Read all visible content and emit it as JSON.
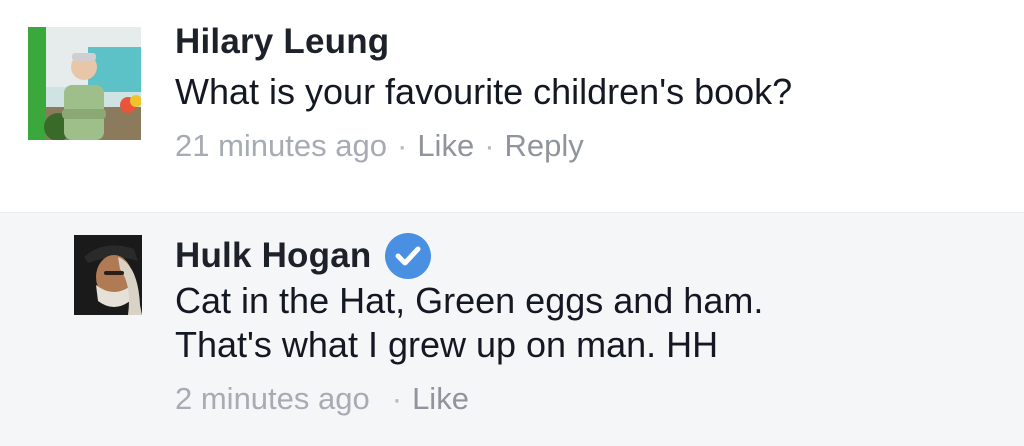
{
  "comments": [
    {
      "author": "Hilary Leung",
      "text_lines": [
        "What is your favourite children's book?"
      ],
      "time": "21 minutes ago",
      "separator": "·",
      "like_label": "Like",
      "reply_label": "Reply",
      "verified": false
    },
    {
      "author": "Hulk Hogan",
      "text_lines": [
        "Cat in the Hat, Green eggs and ham.",
        "That's what I grew up on man. HH"
      ],
      "time": "2 minutes ago",
      "separator": "·",
      "like_label": "Like",
      "verified": true,
      "verified_icon": "verified-checkmark-icon"
    }
  ],
  "colors": {
    "verified_badge": "#4a90e2",
    "meta_text": "#a7abb3",
    "highlight_bg": "#f5f6f8"
  }
}
